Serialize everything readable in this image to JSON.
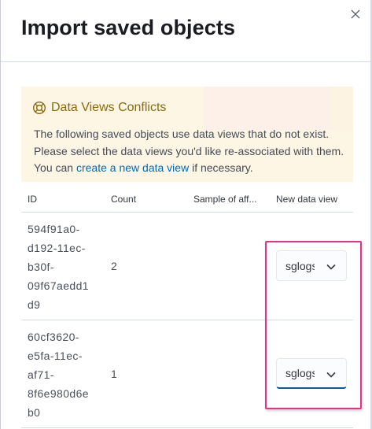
{
  "flyout": {
    "title": "Import saved objects",
    "close_icon": "close-icon"
  },
  "callout": {
    "icon": "help-lifebuoy-icon",
    "title": "Data Views Conflicts",
    "body_before_link": "The following saved objects use data views that do not exist. Please select the data views you'd like re-associated with them. You can ",
    "link": "create a new data view",
    "body_after_link": " if necessary."
  },
  "table": {
    "headers": {
      "id": "ID",
      "count": "Count",
      "sample": "Sample of aff...",
      "new_view": "New data view"
    },
    "rows": [
      {
        "id_lines": [
          "594f91a0-",
          "d192-11ec-",
          "b30f-",
          "09f67aedd1",
          "d9"
        ],
        "count": "2",
        "selected": "sglogs",
        "focused": false
      },
      {
        "id_lines": [
          "60cf3620-",
          "e5fa-11ec-",
          "af71-",
          "8f6e980d6e",
          "b0"
        ],
        "count": "1",
        "selected": "sglogs",
        "focused": true
      }
    ]
  },
  "colors": {
    "callout_bg": "#fef6e5",
    "callout_title": "#8a6a0a",
    "link": "#006bb8",
    "highlight_border": "#e0338c",
    "focus_underline": "#0a5c9e"
  }
}
